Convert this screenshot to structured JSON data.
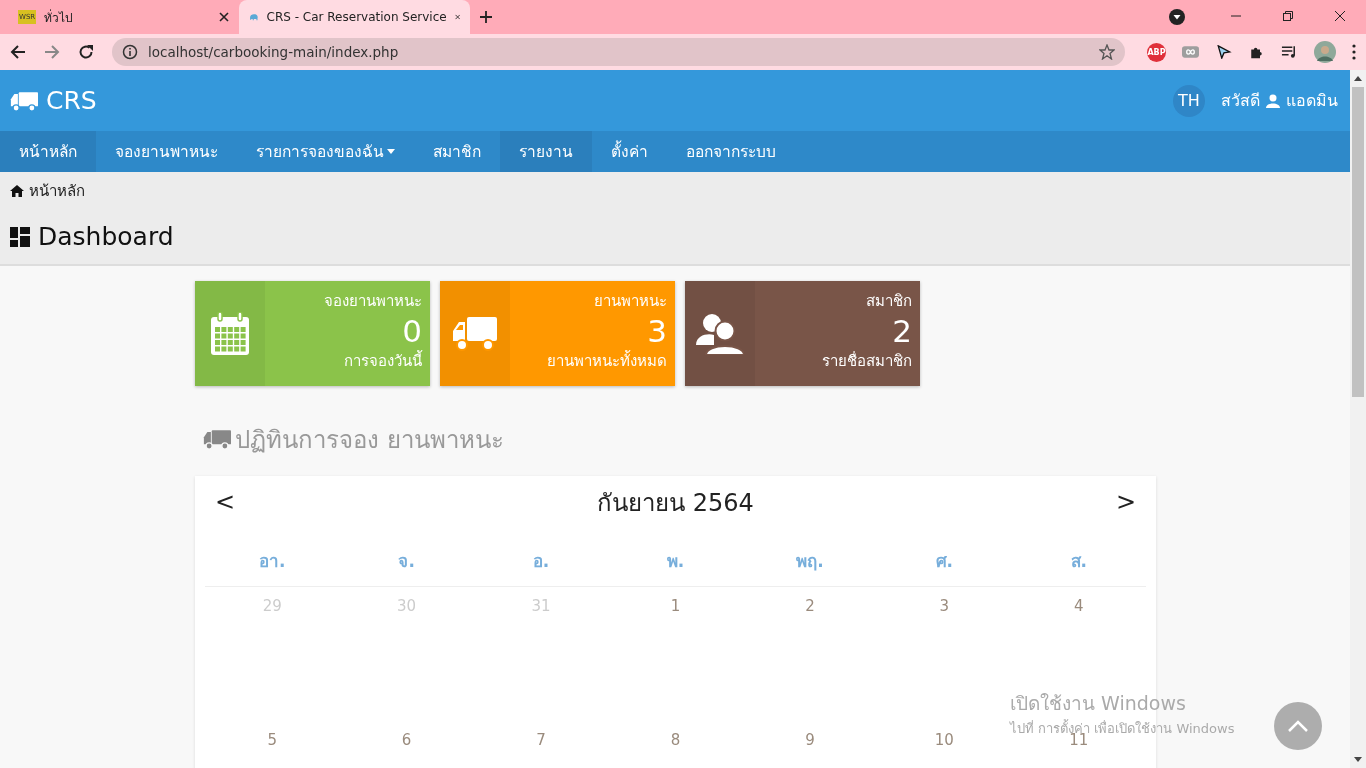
{
  "browser": {
    "tabs": [
      {
        "title": "ทั่วไป",
        "favicon": "WSR",
        "selected": false
      },
      {
        "title": "CRS - Car Reservation Service",
        "selected": true
      }
    ],
    "address": "localhost/carbooking-main/index.php",
    "adblock_label": "ABP"
  },
  "header": {
    "brand": "CRS",
    "lang_badge": "TH",
    "greeting": "สวัสดี",
    "user": "แอดมิน"
  },
  "nav": [
    {
      "label": "หน้าหลัก",
      "selected": true,
      "dropdown": false
    },
    {
      "label": "จองยานพาหนะ",
      "selected": false,
      "dropdown": false
    },
    {
      "label": "รายการจองของฉัน",
      "selected": false,
      "dropdown": true
    },
    {
      "label": "สมาชิก",
      "selected": false,
      "dropdown": false
    },
    {
      "label": "รายงาน",
      "selected": true,
      "dropdown": false
    },
    {
      "label": "ตั้งค่า",
      "selected": false,
      "dropdown": false
    },
    {
      "label": "ออกจากระบบ",
      "selected": false,
      "dropdown": false
    }
  ],
  "breadcrumb": "หน้าหลัก",
  "page_title": "Dashboard",
  "stat_cards": [
    {
      "kind": "calendar",
      "title": "จองยานพาหนะ",
      "value": "0",
      "caption": "การจองวันนี้",
      "color": "#8bc34a"
    },
    {
      "kind": "truck",
      "title": "ยานพาหนะ",
      "value": "3",
      "caption": "ยานพาหนะทั้งหมด",
      "color": "#ff9800"
    },
    {
      "kind": "users",
      "title": "สมาชิก",
      "value": "2",
      "caption": "รายชื่อสมาชิก",
      "color": "#795548"
    }
  ],
  "calendar": {
    "heading": "ปฏิทินการจอง ยานพาหนะ",
    "month": "กันยายน 2564",
    "prev": "<",
    "next": ">",
    "weekdays": [
      "อา.",
      "จ.",
      "อ.",
      "พ.",
      "พฤ.",
      "ศ.",
      "ส."
    ],
    "weeks": [
      [
        {
          "day": "29",
          "other_month": true
        },
        {
          "day": "30",
          "other_month": true
        },
        {
          "day": "31",
          "other_month": true
        },
        {
          "day": "1",
          "other_month": false
        },
        {
          "day": "2",
          "other_month": false
        },
        {
          "day": "3",
          "other_month": false
        },
        {
          "day": "4",
          "other_month": false
        }
      ],
      [
        {
          "day": "5",
          "other_month": false
        },
        {
          "day": "6",
          "other_month": false
        },
        {
          "day": "7",
          "other_month": false
        },
        {
          "day": "8",
          "other_month": false
        },
        {
          "day": "9",
          "other_month": false
        },
        {
          "day": "10",
          "other_month": false
        },
        {
          "day": "11",
          "other_month": false
        }
      ]
    ]
  },
  "os_notice": {
    "title": "เปิดใช้งาน Windows",
    "text": "ไปที่ การตั้งค่า เพื่อเปิดใช้งาน Windows"
  }
}
